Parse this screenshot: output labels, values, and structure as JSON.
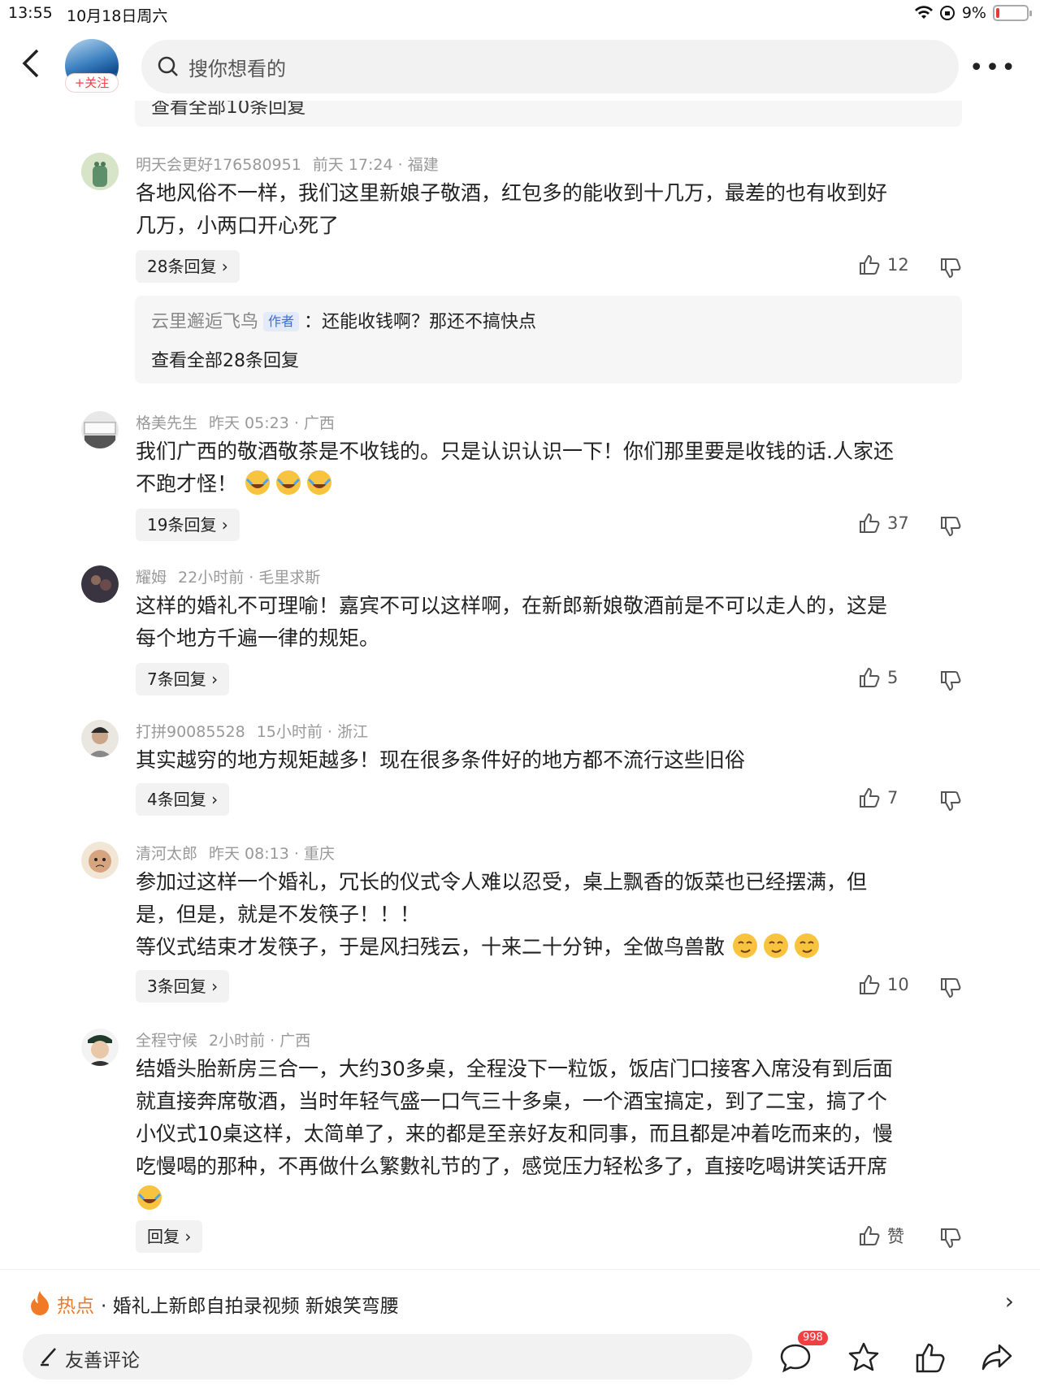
{
  "status_bar": {
    "time": "13:55",
    "date": "10月18日周六",
    "battery": "9%",
    "battery_level": 0.09
  },
  "header": {
    "follow_label": "+关注",
    "search_placeholder": "搜你想看的"
  },
  "remnant_text": "查看全部10条回复",
  "comments": [
    {
      "user": "明天会更好176580951",
      "time": "前天 17:24 · 福建",
      "lines": [
        "各地风俗不一样，我们这里新娘子敬酒，红包多的能收到十几万，最差的也有收到好",
        "几万，小两口开心死了"
      ],
      "replies": "28条回复",
      "likes": "12",
      "sub_reply": {
        "user": "云里邂逅飞鸟",
        "tag": "作者",
        "text": "：还能收钱啊？那还不搞快点",
        "view_all": "查看全部28条回复"
      }
    },
    {
      "user": "格美先生",
      "time": "昨天 05:23 · 广西",
      "lines": [
        "我们广西的敬酒敬茶是不收钱的。只是认识认识一下！你们那里要是收钱的话.人家还",
        "不跑才怪！"
      ],
      "replies": "19条回复",
      "likes": "37"
    },
    {
      "user": "耀姆",
      "time": "22小时前 · 毛里求斯",
      "lines": [
        "这样的婚礼不可理喻！嘉宾不可以这样啊，在新郎新娘敬酒前是不可以走人的，这是",
        "每个地方千遍一律的规矩。"
      ],
      "replies": "7条回复",
      "likes": "5"
    },
    {
      "user": "打拼90085528",
      "time": "15小时前 · 浙江",
      "lines": [
        "其实越穷的地方规矩越多！现在很多条件好的地方都不流行这些旧俗"
      ],
      "replies": "4条回复",
      "likes": "7"
    },
    {
      "user": "清河太郎",
      "time": "昨天 08:13 · 重庆",
      "lines": [
        "参加过这样一个婚礼，冗长的仪式令人难以忍受，桌上飘香的饭菜也已经摆满，但",
        "是，但是，就是不发筷子！！！",
        "等仪式结束才发筷子，于是风扫残云，十来二十分钟，全做鸟兽散"
      ],
      "replies": "3条回复",
      "likes": "10"
    },
    {
      "user": "全程守候",
      "time": "2小时前 · 广西",
      "lines": [
        "结婚头胎新房三合一，大约30多桌，全程没下一粒饭，饭店门口接客入席没有到后面",
        "就直接奔席敬酒，当时年轻气盛一口气三十多桌，一个酒宝搞定，到了二宝，搞了个",
        "小仪式10桌这样，太简单了，来的都是至亲好友和同事，而且都是冲着吃而来的，慢",
        "吃慢喝的那种，不再做什么繁數礼节的了，感觉压力轻松多了，直接吃喝讲笑话开席"
      ],
      "replies": "回复",
      "likes": "赞"
    }
  ],
  "hot": {
    "label": "热点",
    "title": "· 婚礼上新郎自拍录视频 新娘笑弯腰"
  },
  "bottom": {
    "placeholder": "友善评论",
    "comment_count": "998"
  },
  "icons": [
    "back-icon",
    "search-icon",
    "more-icon",
    "like-icon",
    "dislike-icon",
    "fire-icon",
    "pen-icon",
    "comment-icon",
    "star-icon",
    "share-icon"
  ],
  "colors": {
    "accent_red": "#f04142",
    "hot_orange": "#f07a26",
    "author_tag_blue": "#3b6ed4"
  }
}
